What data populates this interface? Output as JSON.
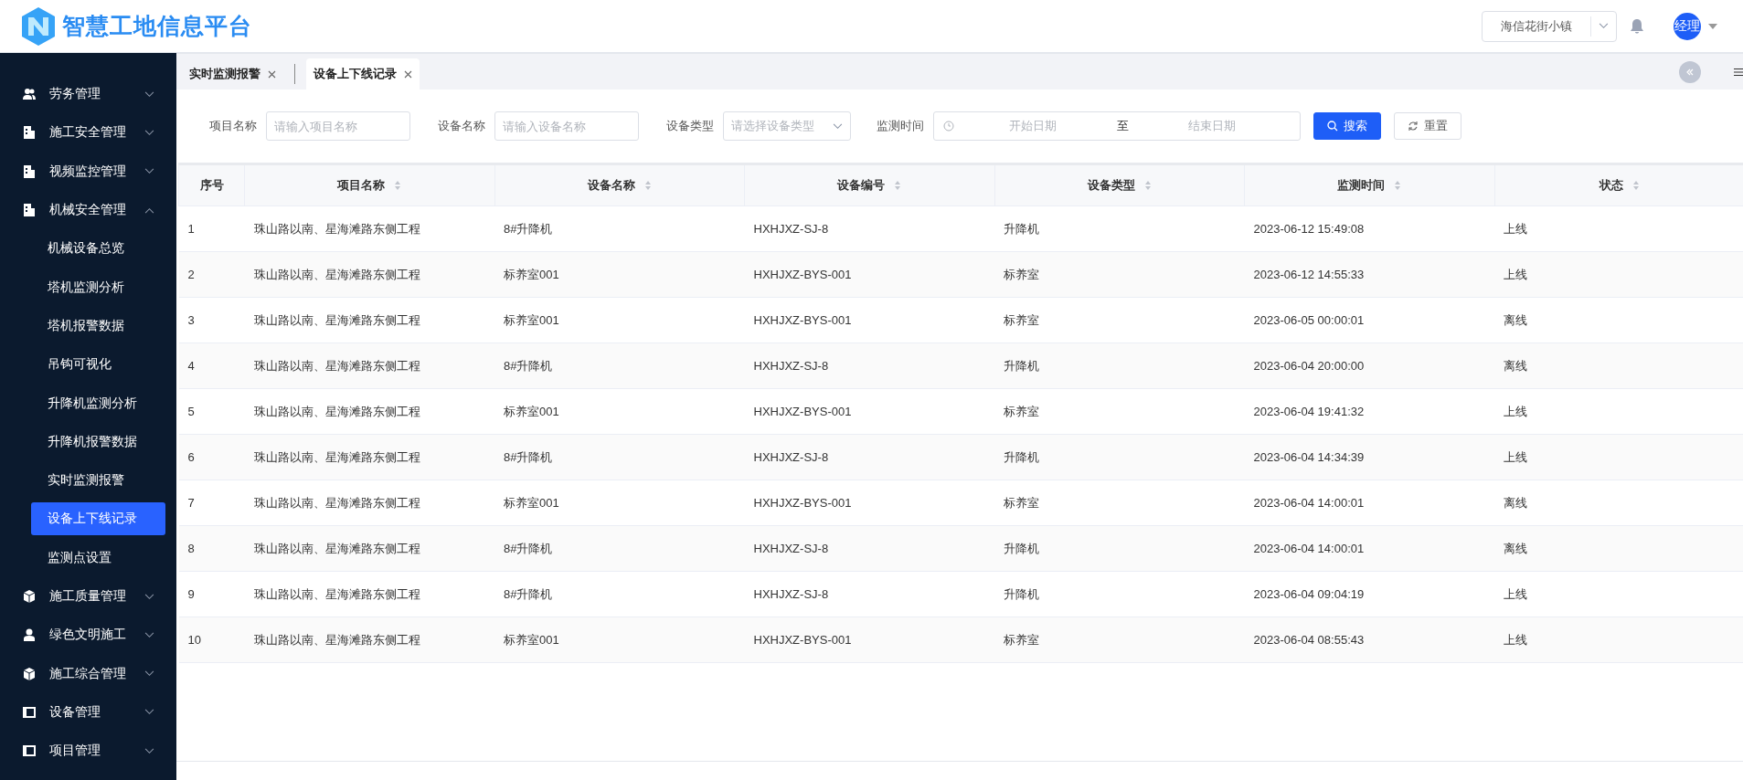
{
  "header": {
    "title": "智慧工地信息平台",
    "project_select": {
      "value": "海信花街小镇"
    },
    "user": {
      "avatar_text": "经理"
    }
  },
  "sidebar": {
    "items": [
      {
        "label": "劳务管理",
        "expanded": false
      },
      {
        "label": "施工安全管理",
        "expanded": false
      },
      {
        "label": "视频监控管理",
        "expanded": false
      },
      {
        "label": "机械安全管理",
        "expanded": true,
        "children": [
          {
            "label": "机械设备总览",
            "selected": false
          },
          {
            "label": "塔机监测分析",
            "selected": false
          },
          {
            "label": "塔机报警数据",
            "selected": false
          },
          {
            "label": "吊钩可视化",
            "selected": false
          },
          {
            "label": "升降机监测分析",
            "selected": false
          },
          {
            "label": "升降机报警数据",
            "selected": false
          },
          {
            "label": "实时监测报警",
            "selected": false
          },
          {
            "label": "设备上下线记录",
            "selected": true
          },
          {
            "label": "监测点设置",
            "selected": false
          }
        ]
      },
      {
        "label": "施工质量管理",
        "expanded": false
      },
      {
        "label": "绿色文明施工",
        "expanded": false
      },
      {
        "label": "施工综合管理",
        "expanded": false
      },
      {
        "label": "设备管理",
        "expanded": false
      },
      {
        "label": "项目管理",
        "expanded": false
      }
    ]
  },
  "tabs": [
    {
      "label": "实时监测报警",
      "selected": false
    },
    {
      "label": "设备上下线记录",
      "selected": true
    }
  ],
  "filters": [
    {
      "kind": "text",
      "label": "项目名称",
      "placeholder": "请输入项目名称"
    },
    {
      "kind": "text",
      "label": "设备名称",
      "placeholder": "请输入设备名称"
    },
    {
      "kind": "select",
      "label": "设备类型",
      "placeholder": "请选择设备类型"
    },
    {
      "kind": "daterange",
      "label": "监测时间",
      "start_placeholder": "开始日期",
      "separator": "至",
      "end_placeholder": "结束日期"
    }
  ],
  "buttons": [
    {
      "kind": "primary",
      "label": "搜索"
    },
    {
      "kind": "default",
      "label": "重置"
    }
  ],
  "table": {
    "columns": [
      {
        "label": "序号",
        "sortable": false
      },
      {
        "label": "项目名称",
        "sortable": true
      },
      {
        "label": "设备名称",
        "sortable": true
      },
      {
        "label": "设备编号",
        "sortable": true
      },
      {
        "label": "设备类型",
        "sortable": true
      },
      {
        "label": "监测时间",
        "sortable": true
      },
      {
        "label": "状态",
        "sortable": true
      }
    ],
    "rows": [
      [
        "1",
        "珠山路以南、星海滩路东侧工程",
        "8#升降机",
        "HXHJXZ-SJ-8",
        "升降机",
        "2023-06-12 15:49:08",
        "上线"
      ],
      [
        "2",
        "珠山路以南、星海滩路东侧工程",
        "标养室001",
        "HXHJXZ-BYS-001",
        "标养室",
        "2023-06-12 14:55:33",
        "上线"
      ],
      [
        "3",
        "珠山路以南、星海滩路东侧工程",
        "标养室001",
        "HXHJXZ-BYS-001",
        "标养室",
        "2023-06-05 00:00:01",
        "离线"
      ],
      [
        "4",
        "珠山路以南、星海滩路东侧工程",
        "8#升降机",
        "HXHJXZ-SJ-8",
        "升降机",
        "2023-06-04 20:00:00",
        "离线"
      ],
      [
        "5",
        "珠山路以南、星海滩路东侧工程",
        "标养室001",
        "HXHJXZ-BYS-001",
        "标养室",
        "2023-06-04 19:41:32",
        "上线"
      ],
      [
        "6",
        "珠山路以南、星海滩路东侧工程",
        "8#升降机",
        "HXHJXZ-SJ-8",
        "升降机",
        "2023-06-04 14:34:39",
        "上线"
      ],
      [
        "7",
        "珠山路以南、星海滩路东侧工程",
        "标养室001",
        "HXHJXZ-BYS-001",
        "标养室",
        "2023-06-04 14:00:01",
        "离线"
      ],
      [
        "8",
        "珠山路以南、星海滩路东侧工程",
        "8#升降机",
        "HXHJXZ-SJ-8",
        "升降机",
        "2023-06-04 14:00:01",
        "离线"
      ],
      [
        "9",
        "珠山路以南、星海滩路东侧工程",
        "8#升降机",
        "HXHJXZ-SJ-8",
        "升降机",
        "2023-06-04 09:04:19",
        "上线"
      ],
      [
        "10",
        "珠山路以南、星海滩路东侧工程",
        "标养室001",
        "HXHJXZ-BYS-001",
        "标养室",
        "2023-06-04 08:55:43",
        "上线"
      ]
    ]
  }
}
